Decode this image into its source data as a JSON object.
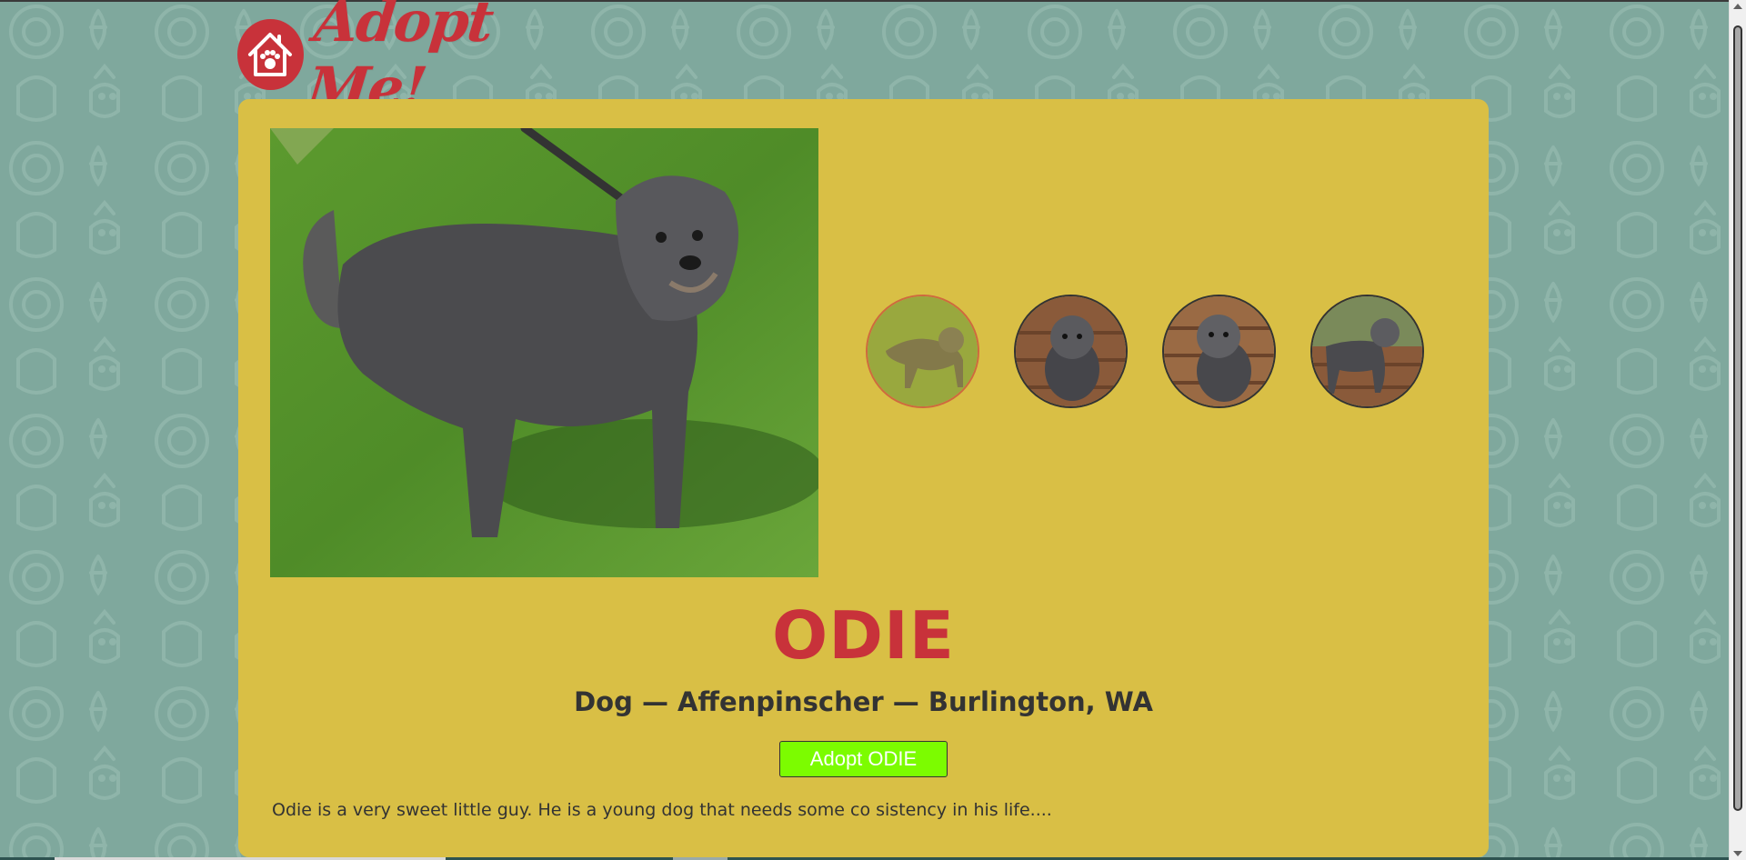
{
  "brand": {
    "name": "Adopt Me!",
    "accent": "#c8323a"
  },
  "pet": {
    "name": "ODIE",
    "animal": "Dog",
    "breed": "Affenpinscher",
    "location": "Burlington, WA",
    "meta_line": "Dog — Affenpinscher — Burlington, WA",
    "adopt_label": "Adopt ODIE",
    "description": "Odie is a very sweet little guy. He is a young dog that needs some co sistency in his life...."
  },
  "carousel": {
    "active_index": 0,
    "thumbnails": [
      {
        "icon": "dog-standing-photo"
      },
      {
        "icon": "dog-sitting-photo"
      },
      {
        "icon": "dog-bench-photo"
      },
      {
        "icon": "dog-standing-bench-photo"
      }
    ]
  },
  "colors": {
    "background": "#7fa89d",
    "card": "#d9bf45",
    "button": "#7cfc00",
    "title": "#c8323a",
    "text": "#333333"
  }
}
